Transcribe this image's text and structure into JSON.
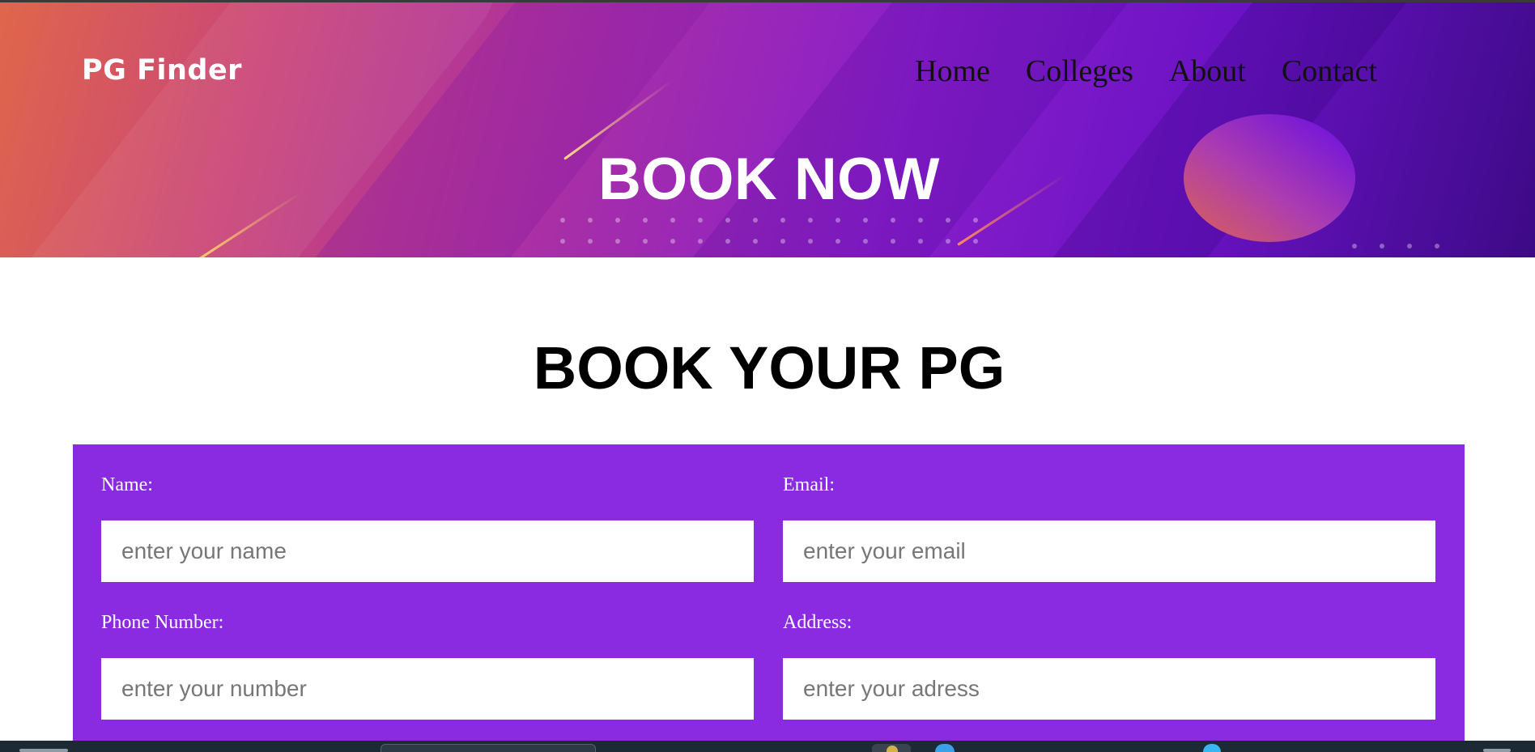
{
  "header": {
    "brand": "PG Finder",
    "nav": [
      "Home",
      "Colleges",
      "About",
      "Contact"
    ],
    "hero_title": "BOOK NOW"
  },
  "main": {
    "section_title": "BOOK YOUR PG"
  },
  "form": {
    "name": {
      "label": "Name:",
      "placeholder": "enter your name",
      "value": ""
    },
    "email": {
      "label": "Email:",
      "placeholder": "enter your email",
      "value": ""
    },
    "phone": {
      "label": "Phone Number:",
      "placeholder": "enter your number",
      "value": ""
    },
    "address": {
      "label": "Address:",
      "placeholder": "enter your adress",
      "value": ""
    }
  },
  "colors": {
    "form_panel": "#8a2be2",
    "hero_gradient_start": "#e0664a",
    "hero_gradient_end": "#3c0a86",
    "heading": "#000000"
  },
  "icons": [
    "taskbar-search-icon",
    "taskbar-app-icon",
    "taskbar-browser-icon",
    "taskbar-edge-icon"
  ]
}
